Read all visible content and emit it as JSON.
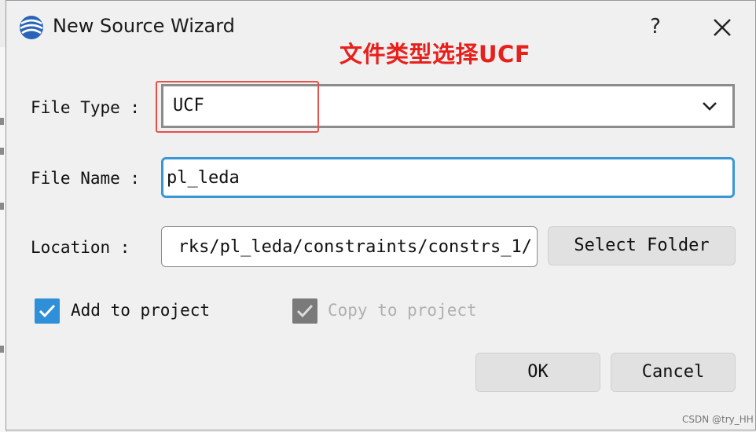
{
  "window": {
    "title": "New Source Wizard",
    "help_label": "?"
  },
  "annotation": {
    "text": "文件类型选择UCF",
    "color": "#e8201c"
  },
  "file_type": {
    "label": "File Type :",
    "value": "UCF"
  },
  "file_name": {
    "label": "File Name :",
    "value": "pl_leda"
  },
  "location": {
    "label": "Location :",
    "value": "rks/pl_leda/constraints/constrs_1/"
  },
  "buttons": {
    "select_folder": "Select Folder",
    "ok": "OK",
    "cancel": "Cancel"
  },
  "checkboxes": {
    "add_to_project": {
      "label": "Add to project",
      "checked": true,
      "enabled": true
    },
    "copy_to_project": {
      "label": "Copy to project",
      "checked": true,
      "enabled": false
    }
  },
  "watermark": "CSDN @try_HH",
  "colors": {
    "accent": "#2f8fd8",
    "focus_border": "#3a97d6",
    "annotation_red": "#e8201c"
  },
  "icons": [
    "app-logo-icon",
    "help-icon",
    "close-icon",
    "chevron-down-icon",
    "checkmark-icon"
  ]
}
